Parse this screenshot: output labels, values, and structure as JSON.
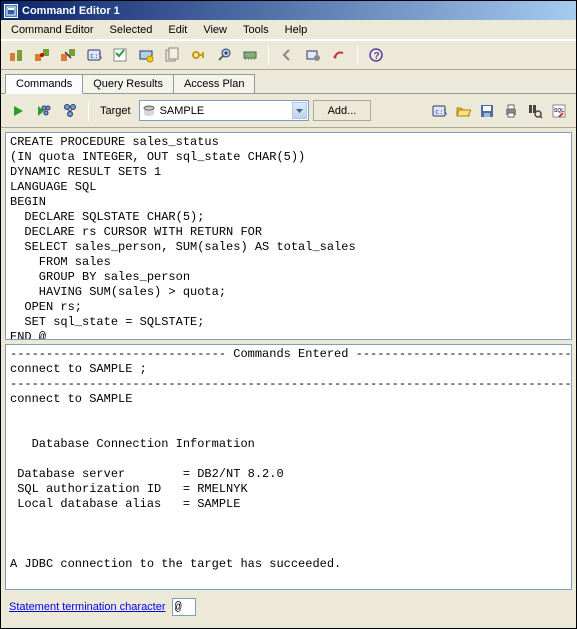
{
  "window": {
    "title": "Command Editor 1"
  },
  "menu": {
    "items": [
      "Command Editor",
      "Selected",
      "Edit",
      "View",
      "Tools",
      "Help"
    ]
  },
  "tabs": {
    "items": [
      "Commands",
      "Query Results",
      "Access Plan"
    ],
    "active": 0
  },
  "cmdbar": {
    "target_label": "Target",
    "target_value": "SAMPLE",
    "add_label": "Add..."
  },
  "editor_text": "CREATE PROCEDURE sales_status\n(IN quota INTEGER, OUT sql_state CHAR(5))\nDYNAMIC RESULT SETS 1\nLANGUAGE SQL\nBEGIN\n  DECLARE SQLSTATE CHAR(5);\n  DECLARE rs CURSOR WITH RETURN FOR\n  SELECT sales_person, SUM(sales) AS total_sales\n    FROM sales\n    GROUP BY sales_person\n    HAVING SUM(sales) > quota;\n  OPEN rs;\n  SET sql_state = SQLSTATE;\nEND @",
  "output_text": "------------------------------ Commands Entered ------------------------------\nconnect to SAMPLE ;\n------------------------------------------------------------------------------\nconnect to SAMPLE\n\n\n   Database Connection Information\n\n Database server        = DB2/NT 8.2.0\n SQL authorization ID   = RMELNYK\n Local database alias   = SAMPLE\n\n\n\nA JDBC connection to the target has succeeded.\n",
  "footer": {
    "link": "Statement termination character",
    "value": "@"
  }
}
